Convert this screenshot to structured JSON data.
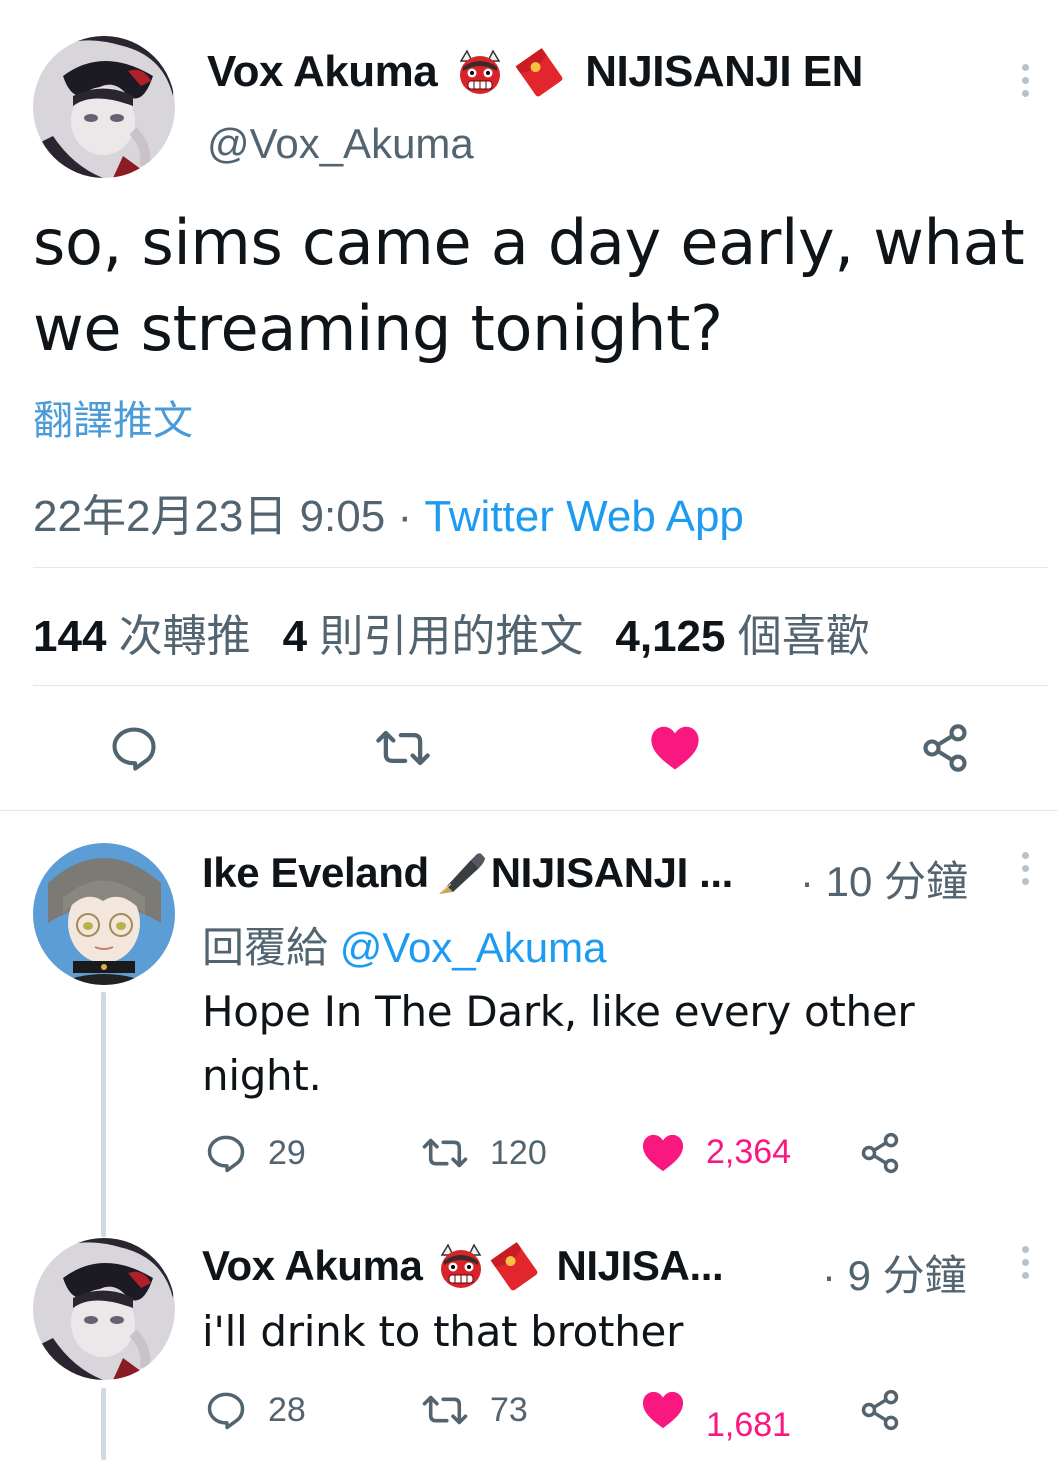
{
  "main_tweet": {
    "author_name": "Vox Akuma",
    "author_suffix": "NIJISANJI EN",
    "handle": "@Vox_Akuma",
    "text": "so, sims came a day early, what we streaming tonight?",
    "translate_label": "翻譯推文",
    "timestamp": "22年2月23日 9:05",
    "separator": " · ",
    "source": "Twitter Web App",
    "stats": {
      "retweets_count": "144",
      "retweets_label": "次轉推",
      "quotes_count": "4",
      "quotes_label": "則引用的推文",
      "likes_count": "4,125",
      "likes_label": "個喜歡"
    },
    "emoji_icons": [
      "ogre-icon",
      "red-envelope-icon"
    ]
  },
  "replies": [
    {
      "author_name": "Ike Eveland",
      "author_suffix": "NIJISANJI ...",
      "time": "· 10 分鐘",
      "reply_to_label": "回覆給",
      "reply_to_handle": "@Vox_Akuma",
      "text": "Hope In The Dark, like every other night.",
      "reply_count": "29",
      "retweet_count": "120",
      "like_count": "2,364",
      "emoji_icons": [
        "fountain-pen-icon"
      ]
    },
    {
      "author_name": "Vox Akuma",
      "author_suffix": "NIJISA...",
      "time": "· 9 分鐘",
      "text": "i'll drink to that brother",
      "reply_count": "28",
      "retweet_count": "73",
      "like_count": "1,681",
      "emoji_icons": [
        "ogre-icon",
        "red-envelope-icon"
      ]
    }
  ],
  "colors": {
    "like_pink": "#f91880",
    "link_blue": "#1d9bf0",
    "muted_gray": "#536471",
    "icon_gray": "#536471"
  }
}
